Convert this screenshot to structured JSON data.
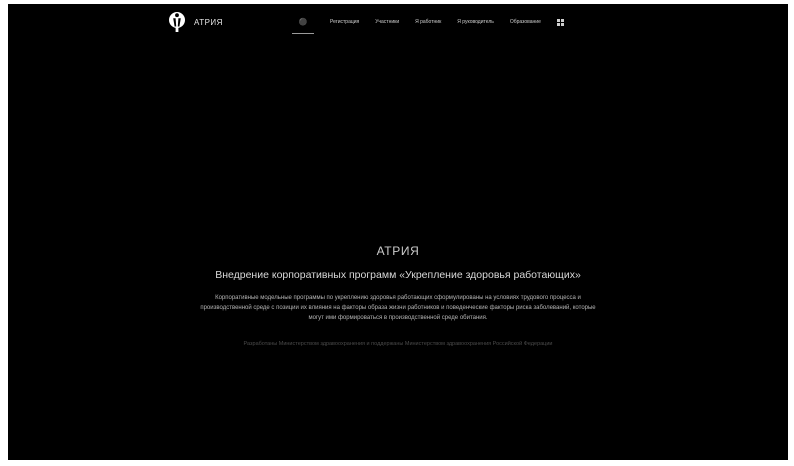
{
  "brand": {
    "name": "АТРИЯ",
    "logo_icon": "person-figure-icon"
  },
  "nav": {
    "home_icon": "home-icon",
    "items": [
      {
        "label": "Регистрация"
      },
      {
        "label": "Участники"
      },
      {
        "label": "Я работник"
      },
      {
        "label": "Я руководитель"
      },
      {
        "label": "Образование"
      }
    ],
    "menu_icon": "grid-icon"
  },
  "hero": {
    "title": "АТРИЯ",
    "subtitle": "Внедрение корпоративных программ «Укрепление здоровья работающих»",
    "description": "Корпоративные модельные программы по укреплению здоровья работающих сформулированы на условиях трудового процесса и производственной среде с позиции их влияния на факторы образа жизни работников и поведенческие факторы риска заболеваний, которые могут ими формироваться в производственной среде обитания.",
    "note": "Разработаны Министерством здравоохранения и поддержаны Министерством здравоохранения Российской Федерации"
  },
  "colors": {
    "background": "#000000",
    "text_primary": "#d8d8d8",
    "text_muted": "#4a4a4a"
  }
}
